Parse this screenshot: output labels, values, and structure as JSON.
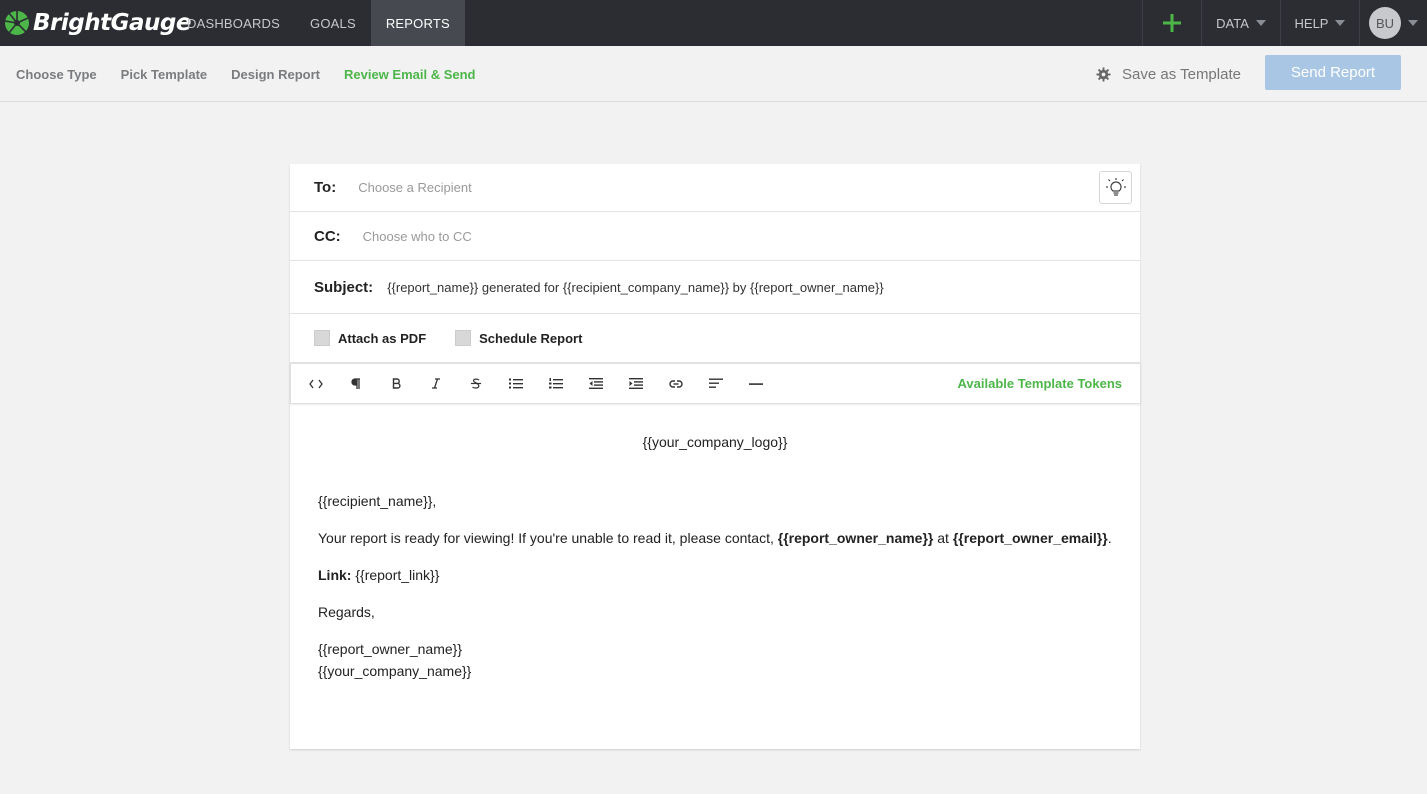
{
  "app": {
    "brand": "BrightGauge"
  },
  "nav": {
    "items": [
      {
        "label": "DASHBOARDS"
      },
      {
        "label": "GOALS"
      },
      {
        "label": "REPORTS"
      }
    ],
    "right": {
      "data_label": "DATA",
      "help_label": "HELP",
      "avatar_initials": "BU"
    }
  },
  "steps": {
    "items": [
      {
        "label": "Choose Type"
      },
      {
        "label": "Pick Template"
      },
      {
        "label": "Design Report"
      },
      {
        "label": "Review Email & Send"
      }
    ],
    "save_template_label": "Save as Template",
    "send_label": "Send Report"
  },
  "form": {
    "to_label": "To:",
    "to_placeholder": "Choose a Recipient",
    "cc_label": "CC:",
    "cc_placeholder": "Choose who to CC",
    "subject_label": "Subject:",
    "subject_value": "{{report_name}} generated for {{recipient_company_name}} by {{report_owner_name}}",
    "attach_pdf_label": "Attach as PDF",
    "schedule_label": "Schedule Report"
  },
  "toolbar": {
    "tokens_label": "Available Template Tokens",
    "buttons": [
      {
        "name": "code-icon",
        "glyph": "<>"
      },
      {
        "name": "paragraph-icon",
        "glyph": "¶"
      },
      {
        "name": "bold-icon",
        "glyph": "B"
      },
      {
        "name": "italic-icon",
        "glyph": "I"
      },
      {
        "name": "strikethrough-icon",
        "glyph": "S"
      },
      {
        "name": "bullet-list-icon",
        "glyph": ""
      },
      {
        "name": "numbered-list-icon",
        "glyph": ""
      },
      {
        "name": "outdent-icon",
        "glyph": ""
      },
      {
        "name": "indent-icon",
        "glyph": ""
      },
      {
        "name": "link-icon",
        "glyph": ""
      },
      {
        "name": "align-left-icon",
        "glyph": ""
      },
      {
        "name": "horizontal-rule-icon",
        "glyph": ""
      }
    ]
  },
  "editor": {
    "logo_token": "{{your_company_logo}}",
    "greeting": "{{recipient_name}},",
    "body_prefix": "Your report is ready for viewing! If you're unable to read it, please contact, ",
    "body_owner": "{{report_owner_name}}",
    "body_at": " at ",
    "body_email": "{{report_owner_email}}",
    "body_suffix": ".",
    "link_label": "Link:",
    "link_value": " {{report_link}}",
    "regards": "Regards,",
    "owner_name": "{{report_owner_name}}",
    "company_name": "{{your_company_name}}"
  },
  "colors": {
    "accent_green": "#4cb649",
    "nav_bg": "#2b2d33",
    "send_button_disabled": "#a9c7e4"
  }
}
